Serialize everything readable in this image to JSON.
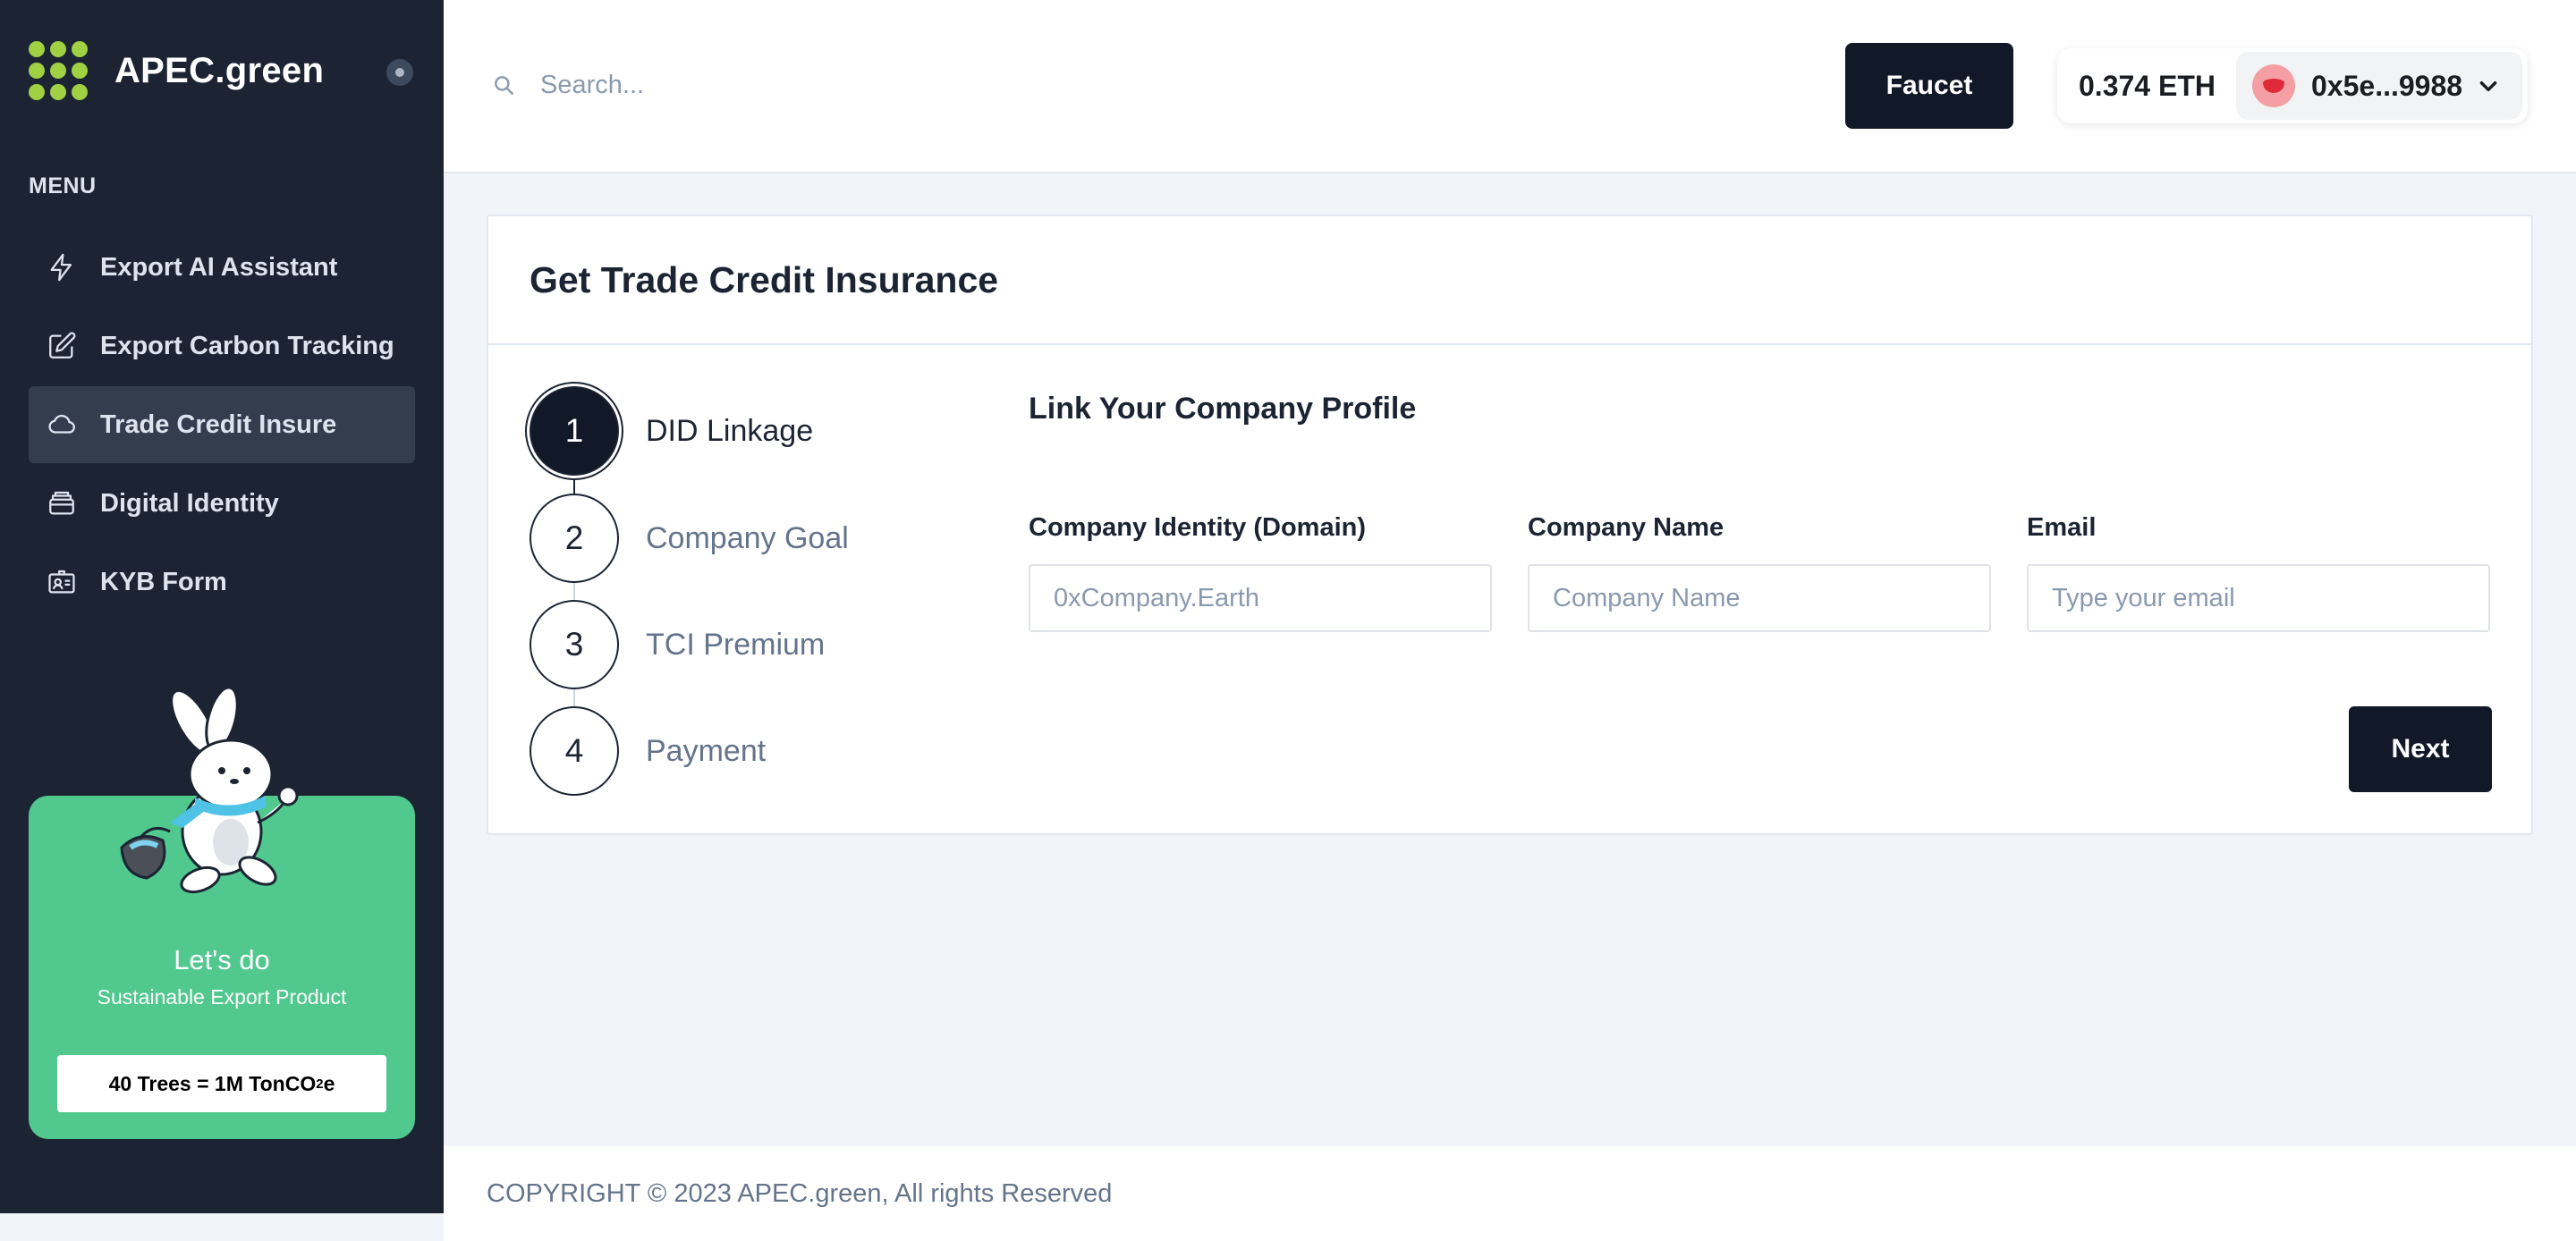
{
  "brand": {
    "name": "APEC.green"
  },
  "sidebar": {
    "menu_heading": "MENU",
    "items": [
      {
        "label": "Export AI Assistant",
        "icon": "lightning-icon"
      },
      {
        "label": "Export Carbon Tracking",
        "icon": "edit-icon"
      },
      {
        "label": "Trade Credit Insure",
        "icon": "cloud-icon",
        "active": true
      },
      {
        "label": "Digital Identity",
        "icon": "archive-icon"
      },
      {
        "label": "KYB Form",
        "icon": "id-card-icon"
      }
    ],
    "promo": {
      "title": "Let's do",
      "subtitle": "Sustainable Export Product",
      "badge_main": "40 Trees = 1M TonCO",
      "badge_sub": "2",
      "badge_end": "e"
    }
  },
  "header": {
    "search_placeholder": "Search...",
    "faucet_label": "Faucet",
    "wallet": {
      "balance": "0.374 ETH",
      "account": "0x5e...9988"
    }
  },
  "main": {
    "card_title": "Get Trade Credit Insurance",
    "steps": [
      {
        "number": "1",
        "label": "DID Linkage",
        "active": true
      },
      {
        "number": "2",
        "label": "Company Goal"
      },
      {
        "number": "3",
        "label": "TCI Premium"
      },
      {
        "number": "4",
        "label": "Payment"
      }
    ],
    "section_title": "Link Your Company Profile",
    "fields": [
      {
        "label": "Company Identity (Domain)",
        "placeholder": "0xCompany.Earth",
        "value": ""
      },
      {
        "label": "Company Name",
        "placeholder": "Company Name",
        "value": ""
      },
      {
        "label": "Email",
        "placeholder": "Type your email",
        "value": ""
      }
    ],
    "next_label": "Next"
  },
  "footer": {
    "copyright": "COPYRIGHT © 2023 APEC.green, All rights Reserved"
  },
  "colors": {
    "sidebar_bg": "#1c2434",
    "accent_green": "#50c88e",
    "logo_green": "#9fd143",
    "button_dark": "#111827"
  }
}
